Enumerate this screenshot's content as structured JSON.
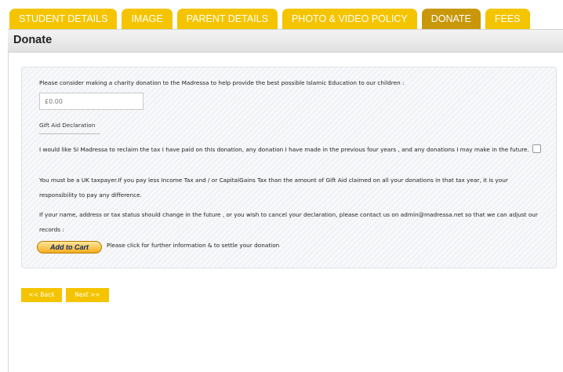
{
  "tabs": [
    {
      "label": "STUDENT DETAILS",
      "active": false
    },
    {
      "label": "IMAGE",
      "active": false
    },
    {
      "label": "PARENT DETAILS",
      "active": false
    },
    {
      "label": "PHOTO & VIDEO POLICY",
      "active": false
    },
    {
      "label": "DONATE",
      "active": true
    },
    {
      "label": "FEES",
      "active": false
    }
  ],
  "page_title": "Donate",
  "donate": {
    "intro": "Please consider making a charity donation to the Madressa to help provide the best possible Islamic Education to our children :",
    "amount_value": "£0.00",
    "gift_aid_label": "Gift Aid Declaration",
    "declaration_text": "I would like SI Madressa to reclaim the tax I have paid on this donation, any donation I have made in the previous four years , and any donations I may make in the future.",
    "declaration_checked": false,
    "taxpayer_text": "You must be a UK taxpayer.If you pay less Income Tax and / or CapitalGains Tax than the amount of Gift Aid claimed on all your donations in that tax year, it is your responsibility to pay any difference.",
    "change_text": "If your name, address or tax status should change in the future , or you wish to cancel your declaration, please contact us on admin@madressa.net so that we can adjust our records :",
    "add_to_cart_label": "Add to Cart",
    "cart_note": "Please click for further information & to settle your donation"
  },
  "nav": {
    "back_label": "<< Back",
    "next_label": "Next >>"
  },
  "colors": {
    "tab": "#f5c400",
    "tab_active": "#c8980a",
    "panel_bg": "#f1f3f6"
  }
}
